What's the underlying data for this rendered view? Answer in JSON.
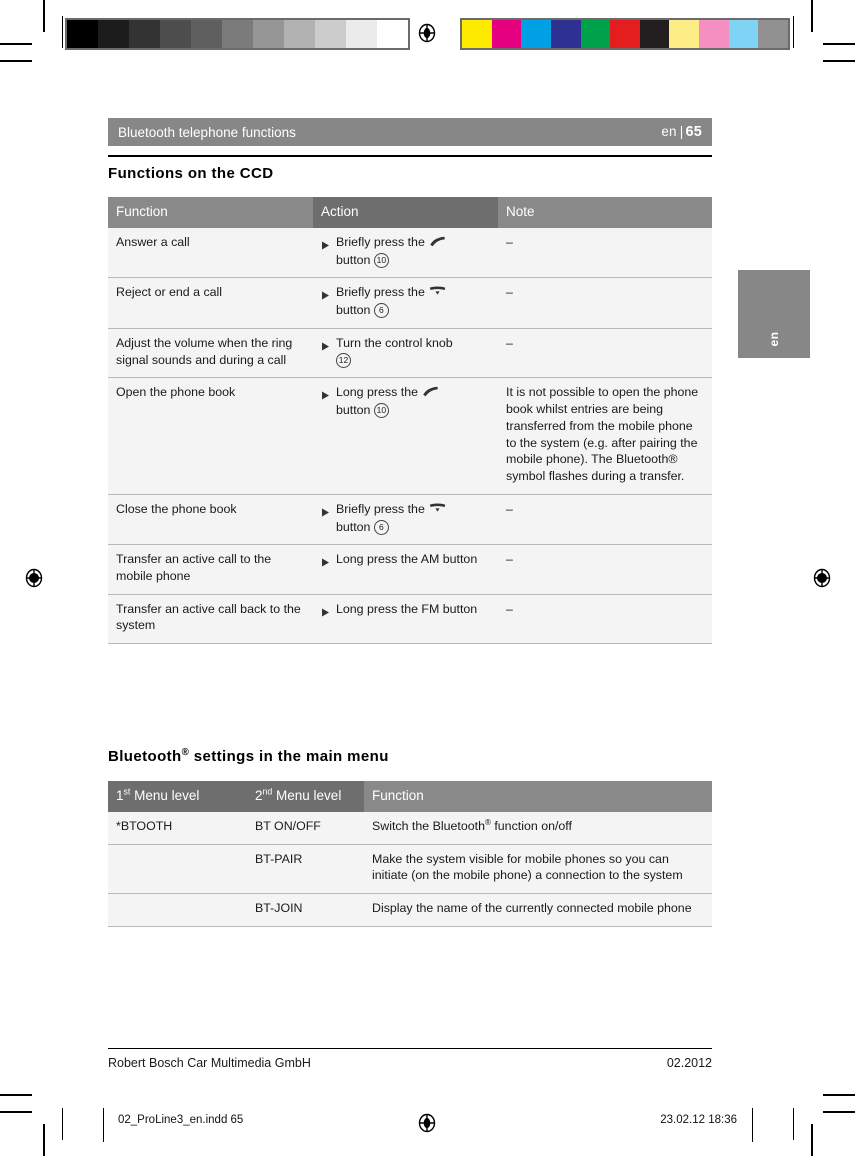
{
  "running_head": {
    "title": "Bluetooth telephone functions",
    "language": "en",
    "separator": "|",
    "page_number": "65"
  },
  "side_tab": {
    "label": "en"
  },
  "sections": [
    {
      "title": "Functions on the CCD",
      "table": {
        "headers": [
          "Function",
          "Action",
          "Note"
        ],
        "rows": [
          {
            "function": "Answer a call",
            "action_prefix": "Briefly press the",
            "action_icon": "phone-pickup-icon",
            "action_suffix": "button",
            "action_ref": "10",
            "note": "–"
          },
          {
            "function": "Reject or end a call",
            "action_prefix": "Briefly press the",
            "action_icon": "phone-hangup-icon",
            "action_suffix": "button",
            "action_ref": "6",
            "note": "–"
          },
          {
            "function": "Adjust the volume when the ring signal sounds and during a call",
            "action_prefix": "Turn the control knob",
            "action_icon": "",
            "action_suffix": "",
            "action_ref": "12",
            "note": "–"
          },
          {
            "function": "Open the phone book",
            "action_prefix": "Long press the",
            "action_icon": "phone-pickup-icon",
            "action_suffix": "button",
            "action_ref": "10",
            "note": "It is not possible to open the phone book whilst entries are being transferred from the mobile phone to the system (e.g. after pairing the mobile phone). The Bluetooth® symbol flashes during a transfer."
          },
          {
            "function": "Close the phone book",
            "action_prefix": "Briefly press the",
            "action_icon": "phone-hangup-icon",
            "action_suffix": "button",
            "action_ref": "6",
            "note": "–"
          },
          {
            "function": "Transfer an active call to the mobile phone",
            "action_prefix": "Long press the AM button",
            "action_icon": "",
            "action_suffix": "",
            "action_ref": "",
            "note": "–"
          },
          {
            "function": "Transfer an active call back to the system",
            "action_prefix": "Long press the FM button",
            "action_icon": "",
            "action_suffix": "",
            "action_ref": "",
            "note": "–"
          }
        ]
      }
    },
    {
      "title": "Bluetooth® settings in the main menu",
      "table": {
        "headers": [
          "1st Menu level",
          "2nd Menu level",
          "Function"
        ],
        "header_ordinals": [
          "st",
          "nd"
        ],
        "rows": [
          {
            "menu1": "*BTOOTH",
            "menu2": "BT ON/OFF",
            "function": "Switch the Bluetooth® function on/off"
          },
          {
            "menu1": "",
            "menu2": "BT-PAIR",
            "function": "Make the system visible for mobile phones so you can initiate (on the mobile phone) a connection to the system"
          },
          {
            "menu1": "",
            "menu2": "BT-JOIN",
            "function": "Display the name of the currently connected mobile phone"
          }
        ]
      }
    }
  ],
  "footer": {
    "company": "Robert Bosch Car Multimedia GmbH",
    "date": "02.2012"
  },
  "slug": {
    "filename": "02_ProLine3_en.indd   65",
    "timestamp": "23.02.12   18:36"
  },
  "calibration": {
    "grayscale_label": "grayscale-calibration-bar",
    "grayscale_steps": [
      "#000000",
      "#1c1c1c",
      "#333333",
      "#4d4d4d",
      "#5f5f5f",
      "#7b7b7b",
      "#969696",
      "#b2b2b2",
      "#cccccc",
      "#ebebeb",
      "#ffffff"
    ],
    "color_label": "color-calibration-bar",
    "color_steps": [
      "#fdea00",
      "#e4007f",
      "#00a0e4",
      "#2e3192",
      "#00a14b",
      "#e41e1e",
      "#231f20",
      "#fced86",
      "#f58fc2",
      "#7fd4f5",
      "#919191"
    ]
  },
  "theme": {
    "header_band": "#878787",
    "header_cell_light": "#898989",
    "header_cell_dark": "#6e6e6e",
    "row_bg": "#f4f4f4",
    "row_bg_alt": "#ececec",
    "rule": "#000000"
  }
}
